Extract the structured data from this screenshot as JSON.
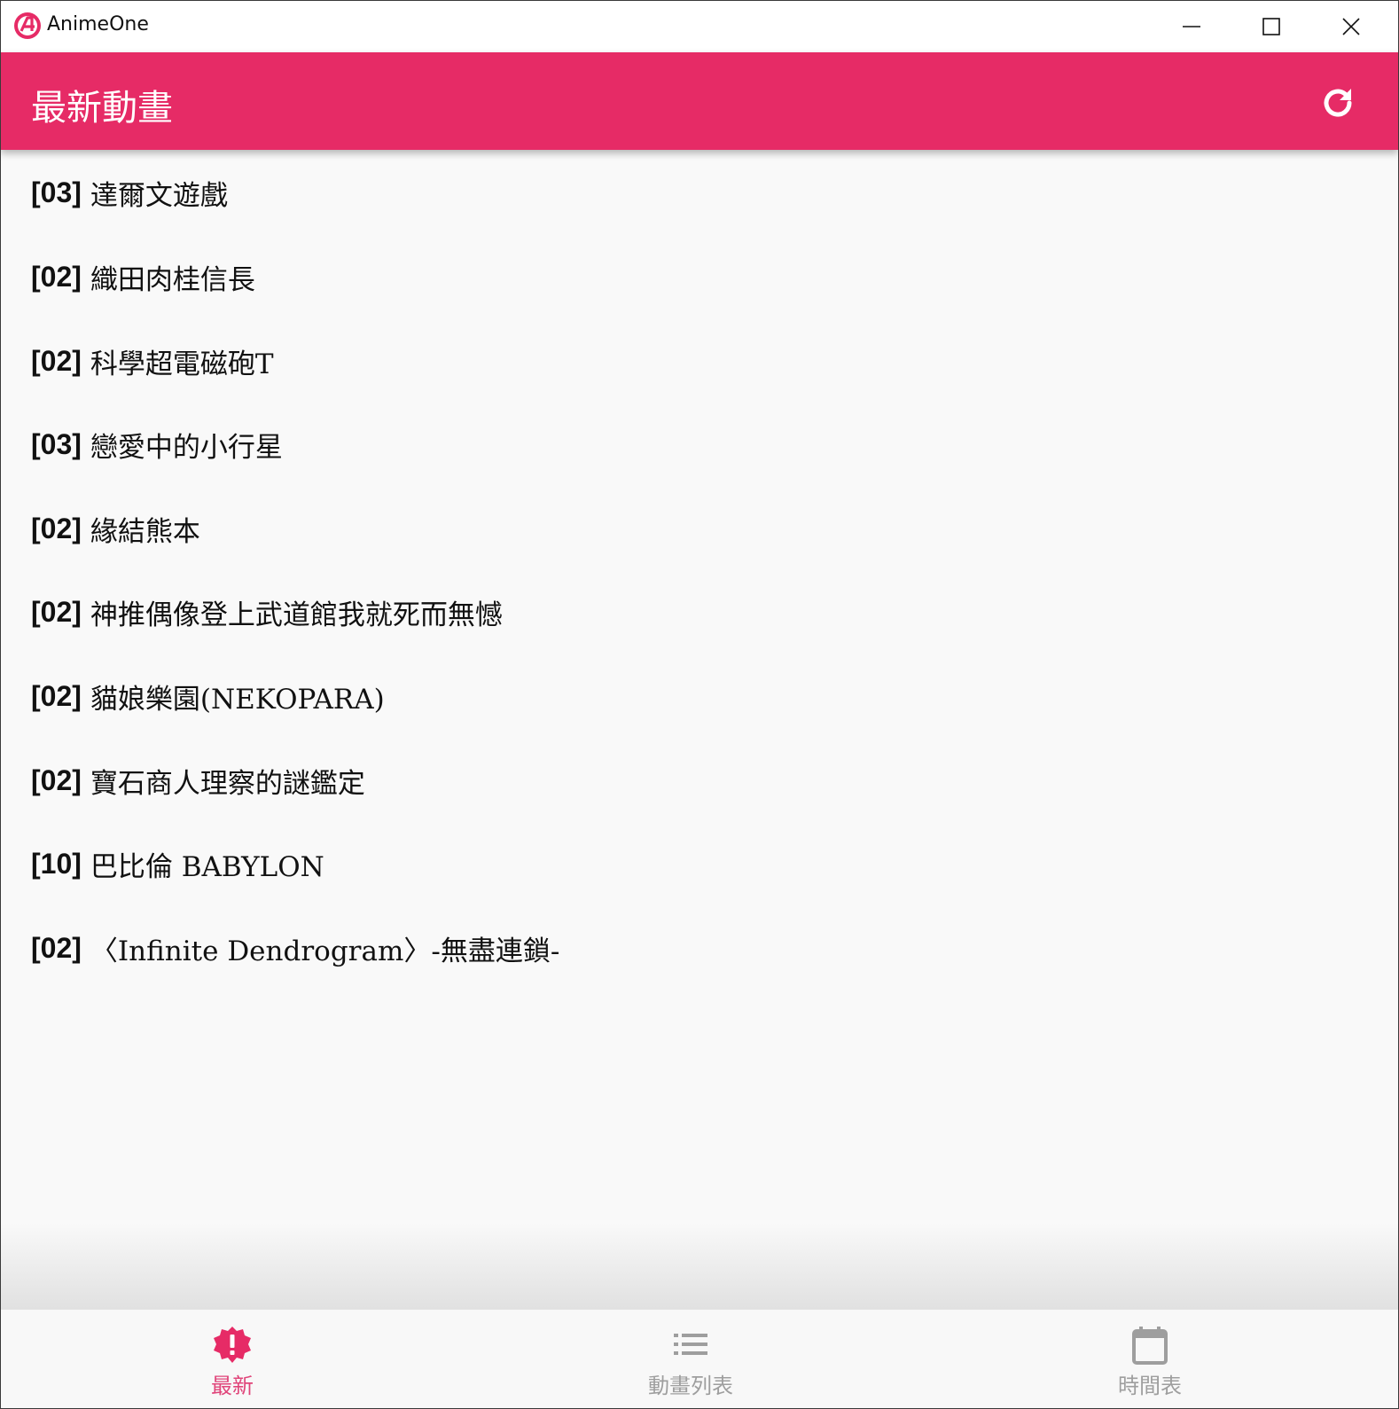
{
  "window": {
    "title": "AnimeOne",
    "logo_text": "A"
  },
  "appbar": {
    "title": "最新動畫",
    "refresh_icon": "refresh-icon"
  },
  "list": [
    {
      "episode": "[03]",
      "name": "達爾文遊戲"
    },
    {
      "episode": "[02]",
      "name": "織田肉桂信長"
    },
    {
      "episode": "[02]",
      "name": "科學超電磁砲T"
    },
    {
      "episode": "[03]",
      "name": "戀愛中的小行星"
    },
    {
      "episode": "[02]",
      "name": "緣結熊本"
    },
    {
      "episode": "[02]",
      "name": "神推偶像登上武道館我就死而無憾"
    },
    {
      "episode": "[02]",
      "name": "貓娘樂園(NEKOPARA)"
    },
    {
      "episode": "[02]",
      "name": "寶石商人理察的謎鑑定"
    },
    {
      "episode": "[10]",
      "name": "巴比倫 BABYLON"
    },
    {
      "episode": "[02]",
      "name": "〈Infinite Dendrogram〉-無盡連鎖-"
    }
  ],
  "bottom_nav": [
    {
      "label": "最新",
      "icon": "new-badge-icon",
      "active": true
    },
    {
      "label": "動畫列表",
      "icon": "list-icon",
      "active": false
    },
    {
      "label": "時間表",
      "icon": "calendar-icon",
      "active": false
    }
  ],
  "colors": {
    "accent": "#e62b66",
    "active_nav": "#e0457a",
    "inactive_nav": "#9e9e9e"
  }
}
